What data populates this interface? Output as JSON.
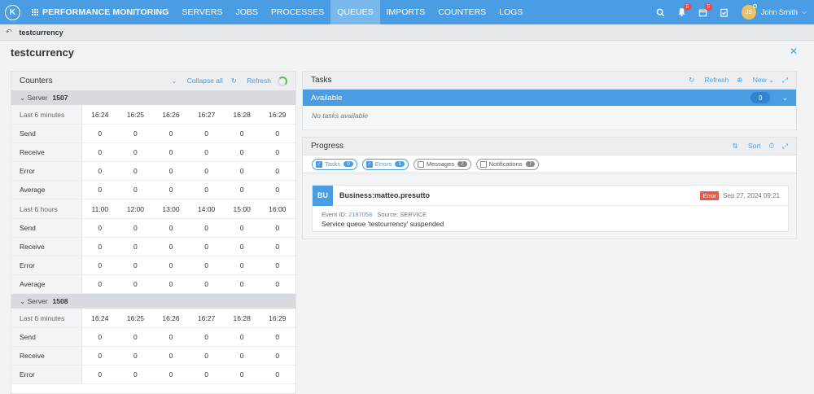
{
  "nav": {
    "logo": "K",
    "brand": "PERFORMANCE MONITORING",
    "items": [
      {
        "label": "SERVERS"
      },
      {
        "label": "JOBS"
      },
      {
        "label": "PROCESSES"
      },
      {
        "label": "QUEUES"
      },
      {
        "label": "IMPORTS"
      },
      {
        "label": "COUNTERS"
      },
      {
        "label": "LOGS"
      }
    ],
    "active_item": "QUEUES",
    "notif_badge": "5",
    "calendar_badge": "5",
    "user_initials": "JS",
    "user_name": "John Smith"
  },
  "breadcrumb": "testcurrency",
  "page_title": "testcurrency",
  "counters": {
    "title": "Counters",
    "collapse_label": "Collapse all",
    "refresh_label": "Refresh",
    "servers": [
      {
        "server_label": "Server",
        "server_id": "1507",
        "minutes_label": "Last 6 minutes",
        "minutes": [
          "16:24",
          "16:25",
          "16:26",
          "16:27",
          "16:28",
          "16:29"
        ],
        "minute_rows": [
          {
            "label": "Send",
            "values": [
              "0",
              "0",
              "0",
              "0",
              "0",
              "0"
            ]
          },
          {
            "label": "Receive",
            "values": [
              "0",
              "0",
              "0",
              "0",
              "0",
              "0"
            ]
          },
          {
            "label": "Error",
            "values": [
              "0",
              "0",
              "0",
              "0",
              "0",
              "0"
            ]
          },
          {
            "label": "Average",
            "values": [
              "0",
              "0",
              "0",
              "0",
              "0",
              "0"
            ]
          }
        ],
        "hours_label": "Last 6 hours",
        "hours": [
          "11:00",
          "12:00",
          "13:00",
          "14:00",
          "15:00",
          "16:00"
        ],
        "hour_rows": [
          {
            "label": "Send",
            "values": [
              "0",
              "0",
              "0",
              "0",
              "0",
              "0"
            ]
          },
          {
            "label": "Receive",
            "values": [
              "0",
              "0",
              "0",
              "0",
              "0",
              "0"
            ]
          },
          {
            "label": "Error",
            "values": [
              "0",
              "0",
              "0",
              "0",
              "0",
              "0"
            ]
          },
          {
            "label": "Average",
            "values": [
              "0",
              "0",
              "0",
              "0",
              "0",
              "0"
            ]
          }
        ]
      },
      {
        "server_label": "Server",
        "server_id": "1508",
        "minutes_label": "Last 6 minutes",
        "minutes": [
          "16:24",
          "16:25",
          "16:26",
          "16:27",
          "16:28",
          "16:29"
        ],
        "minute_rows": [
          {
            "label": "Send",
            "values": [
              "0",
              "0",
              "0",
              "0",
              "0",
              "0"
            ]
          },
          {
            "label": "Receive",
            "values": [
              "0",
              "0",
              "0",
              "0",
              "0",
              "0"
            ]
          },
          {
            "label": "Error",
            "values": [
              "0",
              "0",
              "0",
              "0",
              "0",
              "0"
            ]
          }
        ]
      }
    ]
  },
  "tasks": {
    "title": "Tasks",
    "refresh_label": "Refresh",
    "new_label": "New",
    "available_label": "Available",
    "available_count": "0",
    "empty_text": "No tasks available"
  },
  "progress": {
    "title": "Progress",
    "sort_label": "Sort",
    "filters": [
      {
        "label": "Tasks",
        "count": "0",
        "checked": true
      },
      {
        "label": "Errors",
        "count": "1",
        "checked": true
      },
      {
        "label": "Messages",
        "count": "7",
        "checked": false
      },
      {
        "label": "Notifications",
        "count": "7",
        "checked": false
      }
    ],
    "card": {
      "initials": "BU",
      "title": "Business:matteo.presutto",
      "tag": "Error",
      "date": "Sep 27, 2024 09:21",
      "event_id_label": "Event ID:",
      "event_id": "2187058",
      "source_label": "Source:",
      "source": "SERVICE",
      "message": "Service queue 'testcurrency' suspended"
    }
  },
  "colors": {
    "primary": "#4a9de3",
    "error": "#e55a4a",
    "success": "#5cb85c"
  }
}
